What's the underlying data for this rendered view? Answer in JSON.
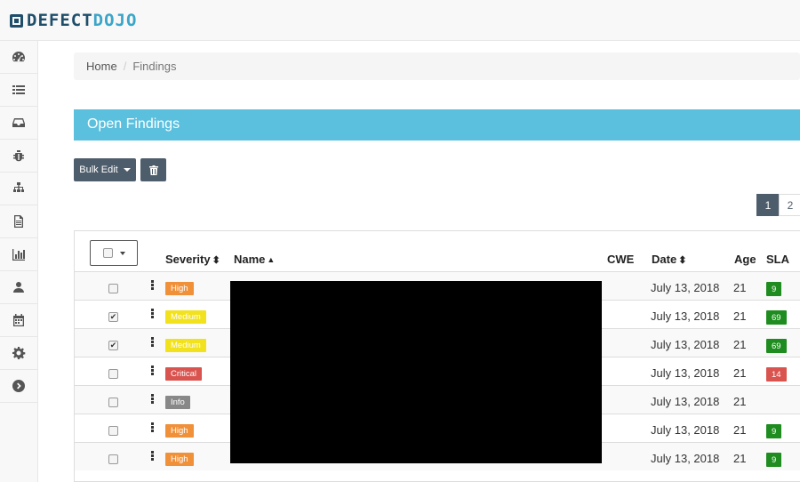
{
  "brand": {
    "part1": "DEFECT",
    "part2": "DOJO"
  },
  "sidebar": {
    "items": [
      {
        "icon": "dashboard-icon"
      },
      {
        "icon": "list-icon"
      },
      {
        "icon": "inbox-icon"
      },
      {
        "icon": "bug-icon"
      },
      {
        "icon": "sitemap-icon"
      },
      {
        "icon": "file-text-icon"
      },
      {
        "icon": "bar-chart-icon"
      },
      {
        "icon": "user-icon"
      },
      {
        "icon": "calendar-icon"
      },
      {
        "icon": "gear-icon"
      },
      {
        "icon": "arrow-circle-right-icon"
      }
    ]
  },
  "breadcrumb": {
    "home": "Home",
    "separator": "/",
    "current": "Findings"
  },
  "panel": {
    "title": "Open Findings"
  },
  "toolbar": {
    "bulk_edit": "Bulk Edit",
    "delete_icon": "trash-icon"
  },
  "pagination": {
    "current": "1",
    "next": "2"
  },
  "table": {
    "headers": {
      "severity": "Severity",
      "name": "Name",
      "cwe": "CWE",
      "date": "Date",
      "age": "Age",
      "sla": "SLA"
    },
    "rows": [
      {
        "checked": false,
        "severity": "High",
        "severity_color": "#f0913a",
        "date": "July 13, 2018",
        "age": "21",
        "sla": "9",
        "sla_color": "#1e8c1e"
      },
      {
        "checked": true,
        "severity": "Medium",
        "severity_color": "#f2e11d",
        "date": "July 13, 2018",
        "age": "21",
        "sla": "69",
        "sla_color": "#1e8c1e"
      },
      {
        "checked": true,
        "severity": "Medium",
        "severity_color": "#f2e11d",
        "date": "July 13, 2018",
        "age": "21",
        "sla": "69",
        "sla_color": "#1e8c1e"
      },
      {
        "checked": false,
        "severity": "Critical",
        "severity_color": "#d9534f",
        "date": "July 13, 2018",
        "age": "21",
        "sla": "14",
        "sla_color": "#d9534f"
      },
      {
        "checked": false,
        "severity": "Info",
        "severity_color": "#888888",
        "date": "July 13, 2018",
        "age": "21",
        "sla": "",
        "sla_color": ""
      },
      {
        "checked": false,
        "severity": "High",
        "severity_color": "#f0913a",
        "date": "July 13, 2018",
        "age": "21",
        "sla": "9",
        "sla_color": "#1e8c1e"
      },
      {
        "checked": false,
        "severity": "High",
        "severity_color": "#f0913a",
        "date": "July 13, 2018",
        "age": "21",
        "sla": "9",
        "sla_color": "#1e8c1e"
      }
    ]
  }
}
